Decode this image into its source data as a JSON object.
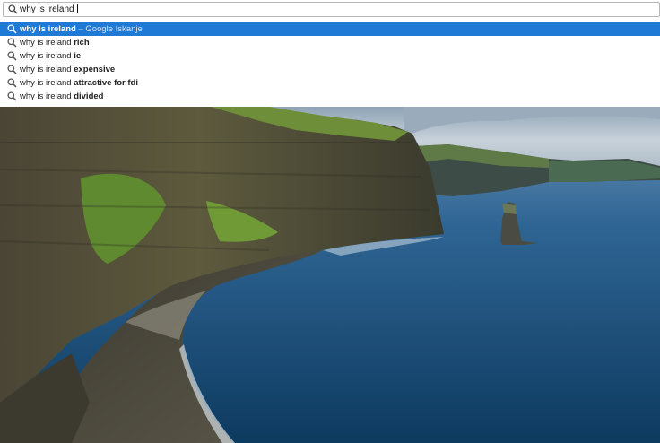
{
  "omnibox": {
    "query": "why is ireland",
    "icon": "search-icon"
  },
  "suggestions": [
    {
      "prefix": "why is ireland",
      "suffix": " – Google Iskanje",
      "selected": true,
      "icon": "search-icon"
    },
    {
      "prefix": "why is ireland ",
      "suffix": "rich",
      "selected": false,
      "icon": "search-icon"
    },
    {
      "prefix": "why is ireland ",
      "suffix": "ie",
      "selected": false,
      "icon": "search-icon"
    },
    {
      "prefix": "why is ireland ",
      "suffix": "expensive",
      "selected": false,
      "icon": "search-icon"
    },
    {
      "prefix": "why is ireland ",
      "suffix": "attractive for fdi",
      "selected": false,
      "icon": "search-icon"
    },
    {
      "prefix": "why is ireland ",
      "suffix": "divided",
      "selected": false,
      "icon": "search-icon"
    }
  ],
  "colors": {
    "selection": "#1f7ad6",
    "selection_hint": "#cfe3ff",
    "text": "#222222"
  }
}
